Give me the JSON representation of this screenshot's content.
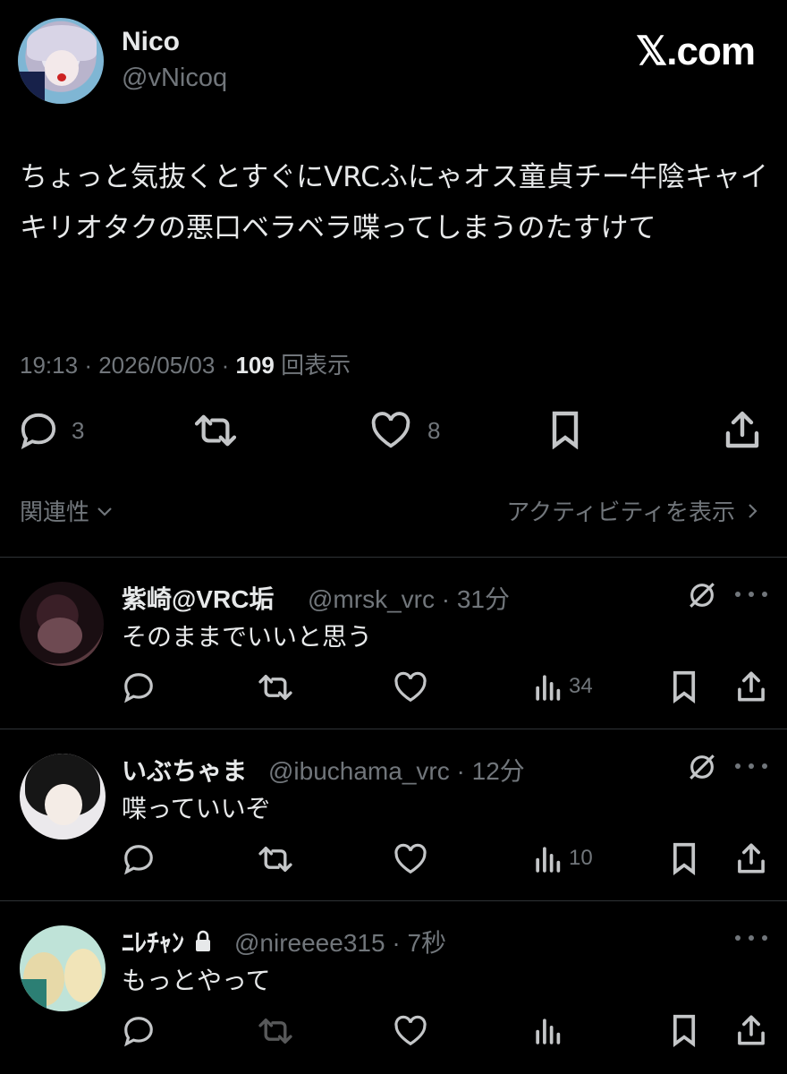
{
  "tweet": {
    "author_name": "Nico",
    "author_handle": "@vNicoq",
    "site": "𝕏.com",
    "body": "ちょっと気抜くとすぐにVRCふにゃオス童貞チー牛陰キャイキリオタクの悪口ベラベラ喋ってしまうのたすけて",
    "time": "19:13",
    "date": "2026/05/03",
    "views": "109",
    "views_label": "回表示",
    "reply_count": "3",
    "like_count": "8"
  },
  "sort": {
    "label": "関連性",
    "activity_label": "アクティビティを表示"
  },
  "replies": [
    {
      "name": "紫崎@VRC垢",
      "handle": "@mrsk_vrc",
      "time": "31分",
      "text": "そのままでいいと思う",
      "views": "34"
    },
    {
      "name": "いぶちゃま",
      "handle": "@ibuchama_vrc",
      "time": "12分",
      "text": "喋っていいぞ",
      "views": "10"
    },
    {
      "name": "ﾆﾚﾁｬﾝ",
      "handle": "@nireeee315",
      "time": "7秒",
      "text": "もっとやって",
      "views": ""
    }
  ],
  "icons": {
    "reply": "reply-icon",
    "retweet": "retweet-icon",
    "like": "heart-icon",
    "bookmark": "bookmark-icon",
    "share": "share-icon",
    "views": "views-bar-icon",
    "grok": "grok-icon",
    "more": "more-icon",
    "lock": "lock-icon"
  }
}
